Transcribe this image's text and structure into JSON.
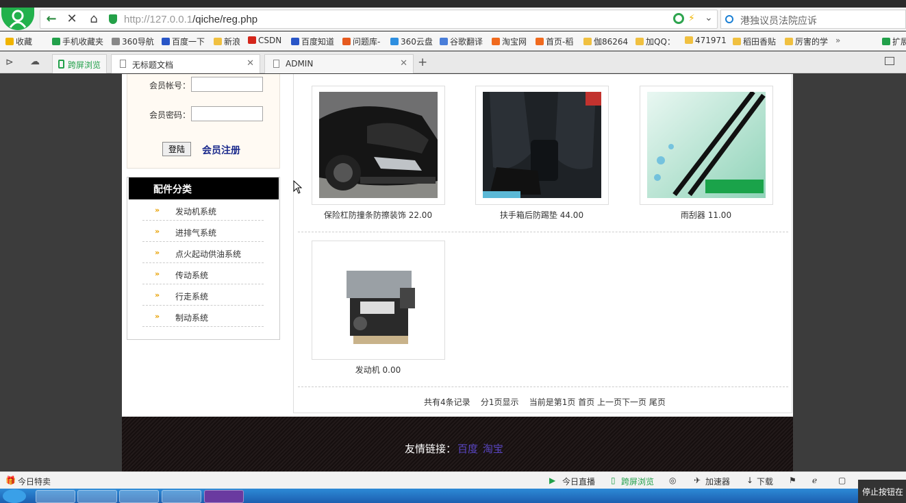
{
  "browser": {
    "url_prefix": "http://127.0.0.1",
    "url_path": "/qiche/reg.php",
    "search_text": "港独议员法院应诉"
  },
  "bookmarks": [
    {
      "label": "收藏",
      "color": "#f0b400"
    },
    {
      "label": "手机收藏夹",
      "color": "#22a04a"
    },
    {
      "label": "360导航",
      "color": "#888888"
    },
    {
      "label": "百度一下",
      "color": "#2956c7"
    },
    {
      "label": "新浪",
      "color": "#f0c040"
    },
    {
      "label": "CSDN",
      "color": "#d4261b"
    },
    {
      "label": "百度知道",
      "color": "#2956c7"
    },
    {
      "label": "问题库-",
      "color": "#e65a1f"
    },
    {
      "label": "360云盘",
      "color": "#2e8fe0"
    },
    {
      "label": "谷歌翻译",
      "color": "#4a7ed9"
    },
    {
      "label": "淘宝网",
      "color": "#f06a1e"
    },
    {
      "label": "首页-稻",
      "color": "#f06a1e"
    },
    {
      "label": "伽86264",
      "color": "#f0c040"
    },
    {
      "label": "加QQ：",
      "color": "#f0c040"
    },
    {
      "label": "471971",
      "color": "#f0c040"
    },
    {
      "label": "稻田香贴",
      "color": "#f0c040"
    },
    {
      "label": "厉害的学",
      "color": "#f0c040"
    },
    {
      "label": "扩展",
      "color": "#22a04a"
    }
  ],
  "tabs": {
    "kuaping": "跨屏浏览",
    "items": [
      {
        "label": "无标题文档"
      },
      {
        "label": "ADMIN"
      }
    ]
  },
  "login": {
    "account_label": "会员帐号：",
    "password_label": "会员密码：",
    "login_button": "登陆",
    "register_link": "会员注册"
  },
  "categories": {
    "title": "配件分类",
    "items": [
      "发动机系统",
      "进排气系统",
      "点火起动供油系统",
      "传动系统",
      "行走系统",
      "制动系统"
    ]
  },
  "products": [
    {
      "name": "保险杠防撞条防擦装饰 22.00"
    },
    {
      "name": "扶手箱后防踢垫 44.00"
    },
    {
      "name": "雨刮器 11.00"
    },
    {
      "name": "发动机 0.00"
    }
  ],
  "pager": {
    "text": "共有4条记录    分1页显示    当前是第1页 首页 上一页下一页 尾页"
  },
  "footer": {
    "label": "友情链接：",
    "links": [
      "百度",
      "淘宝"
    ]
  },
  "statusbar": {
    "left": "今日特卖",
    "live": "今日直播",
    "kuaping": "跨屏浏览",
    "accel": "加速器",
    "download": "下载"
  },
  "tooltip": "停止按钮在"
}
